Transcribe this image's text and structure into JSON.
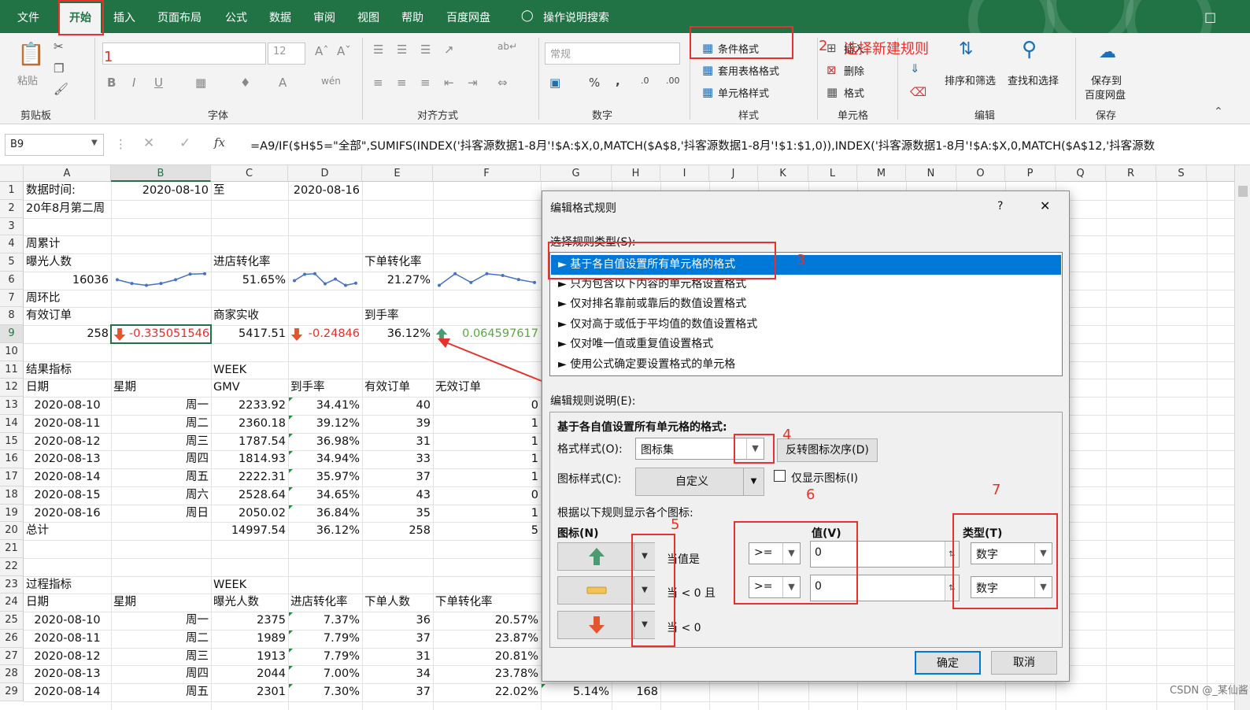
{
  "menu": {
    "items": [
      "文件",
      "开始",
      "插入",
      "页面布局",
      "公式",
      "数据",
      "审阅",
      "视图",
      "帮助",
      "百度网盘",
      "操作说明搜索"
    ],
    "active_index": 1
  },
  "ribbon": {
    "paste": "粘贴",
    "font_size": "12",
    "number_format": "常规",
    "conditional_format": "条件格式",
    "table_format": "套用表格格式",
    "cell_style": "单元格样式",
    "insert": "插入",
    "delete": "删除",
    "format": "格式",
    "sort_filter": "排序和筛选",
    "find_select": "查找和选择",
    "save_to": "保存到",
    "baidu_netdisk": "百度网盘",
    "groups": {
      "clipboard": "剪贴板",
      "font": "字体",
      "align": "对齐方式",
      "number": "数字",
      "style": "样式",
      "cells": "单元格",
      "edit": "编辑",
      "save": "保存"
    }
  },
  "formula_bar": {
    "name_box": "B9",
    "fx": "fx",
    "formula": "=A9/IF($H$5=\"全部\",SUMIFS(INDEX('抖客源数据1-8月'!$A:$X,0,MATCH($A$8,'抖客源数据1-8月'!$1:$1,0)),INDEX('抖客源数据1-8月'!$A:$X,0,MATCH($A$12,'抖客源数"
  },
  "columns": [
    "A",
    "B",
    "C",
    "D",
    "E",
    "F",
    "G",
    "H",
    "I",
    "J",
    "K",
    "L",
    "M",
    "N",
    "O",
    "P",
    "Q",
    "R",
    "S"
  ],
  "rows": [
    "1",
    "2",
    "3",
    "4",
    "5",
    "6",
    "7",
    "8",
    "9",
    "10",
    "11",
    "12",
    "13",
    "14",
    "15",
    "16",
    "17",
    "18",
    "19",
    "20",
    "21",
    "22",
    "23",
    "24",
    "25",
    "26",
    "27",
    "28",
    "29"
  ],
  "cells": [
    [
      "1",
      "A",
      "数据时间:"
    ],
    [
      "1",
      "B",
      "2020-08-10"
    ],
    [
      "1",
      "C",
      "至"
    ],
    [
      "1",
      "D",
      "2020-08-16"
    ],
    [
      "2",
      "A",
      "20年8月第二周"
    ],
    [
      "4",
      "A",
      "周累计"
    ],
    [
      "5",
      "A",
      "曝光人数"
    ],
    [
      "5",
      "C",
      "进店转化率"
    ],
    [
      "5",
      "E",
      "下单转化率"
    ],
    [
      "6",
      "A",
      "16036"
    ],
    [
      "6",
      "C",
      "51.65%"
    ],
    [
      "6",
      "E",
      "21.27%"
    ],
    [
      "7",
      "A",
      "周环比"
    ],
    [
      "8",
      "A",
      "有效订单"
    ],
    [
      "8",
      "C",
      "商家实收"
    ],
    [
      "8",
      "E",
      "到手率"
    ],
    [
      "9",
      "A",
      "258"
    ],
    [
      "9",
      "B",
      "-0.335051546"
    ],
    [
      "9",
      "C",
      "5417.51"
    ],
    [
      "9",
      "D",
      "-0.24846"
    ],
    [
      "9",
      "E",
      "36.12%"
    ],
    [
      "9",
      "F",
      "0.064597617"
    ],
    [
      "11",
      "A",
      "结果指标"
    ],
    [
      "11",
      "C",
      "WEEK"
    ],
    [
      "12",
      "A",
      "日期"
    ],
    [
      "12",
      "B",
      "星期"
    ],
    [
      "12",
      "C",
      "GMV"
    ],
    [
      "12",
      "D",
      "到手率"
    ],
    [
      "12",
      "E",
      "有效订单"
    ],
    [
      "12",
      "F",
      "无效订单"
    ],
    [
      "13",
      "A",
      "2020-08-10"
    ],
    [
      "13",
      "B",
      "周一"
    ],
    [
      "13",
      "C",
      "2233.92"
    ],
    [
      "13",
      "D",
      "34.41%"
    ],
    [
      "13",
      "E",
      "40"
    ],
    [
      "13",
      "F",
      "0"
    ],
    [
      "14",
      "A",
      "2020-08-11"
    ],
    [
      "14",
      "B",
      "周二"
    ],
    [
      "14",
      "C",
      "2360.18"
    ],
    [
      "14",
      "D",
      "39.12%"
    ],
    [
      "14",
      "E",
      "39"
    ],
    [
      "14",
      "F",
      "1"
    ],
    [
      "15",
      "A",
      "2020-08-12"
    ],
    [
      "15",
      "B",
      "周三"
    ],
    [
      "15",
      "C",
      "1787.54"
    ],
    [
      "15",
      "D",
      "36.98%"
    ],
    [
      "15",
      "E",
      "31"
    ],
    [
      "15",
      "F",
      "1"
    ],
    [
      "16",
      "A",
      "2020-08-13"
    ],
    [
      "16",
      "B",
      "周四"
    ],
    [
      "16",
      "C",
      "1814.93"
    ],
    [
      "16",
      "D",
      "34.94%"
    ],
    [
      "16",
      "E",
      "33"
    ],
    [
      "16",
      "F",
      "1"
    ],
    [
      "17",
      "A",
      "2020-08-14"
    ],
    [
      "17",
      "B",
      "周五"
    ],
    [
      "17",
      "C",
      "2222.31"
    ],
    [
      "17",
      "D",
      "35.97%"
    ],
    [
      "17",
      "E",
      "37"
    ],
    [
      "17",
      "F",
      "1"
    ],
    [
      "18",
      "A",
      "2020-08-15"
    ],
    [
      "18",
      "B",
      "周六"
    ],
    [
      "18",
      "C",
      "2528.64"
    ],
    [
      "18",
      "D",
      "34.65%"
    ],
    [
      "18",
      "E",
      "43"
    ],
    [
      "18",
      "F",
      "0"
    ],
    [
      "19",
      "A",
      "2020-08-16"
    ],
    [
      "19",
      "B",
      "周日"
    ],
    [
      "19",
      "C",
      "2050.02"
    ],
    [
      "19",
      "D",
      "36.84%"
    ],
    [
      "19",
      "E",
      "35"
    ],
    [
      "19",
      "F",
      "1"
    ],
    [
      "20",
      "A",
      "总计"
    ],
    [
      "20",
      "C",
      "14997.54"
    ],
    [
      "20",
      "D",
      "36.12%"
    ],
    [
      "20",
      "E",
      "258"
    ],
    [
      "20",
      "F",
      "5"
    ],
    [
      "23",
      "A",
      "过程指标"
    ],
    [
      "23",
      "C",
      "WEEK"
    ],
    [
      "24",
      "A",
      "日期"
    ],
    [
      "24",
      "B",
      "星期"
    ],
    [
      "24",
      "C",
      "曝光人数"
    ],
    [
      "24",
      "D",
      "进店转化率"
    ],
    [
      "24",
      "E",
      "下单人数"
    ],
    [
      "24",
      "F",
      "下单转化率"
    ],
    [
      "25",
      "A",
      "2020-08-10"
    ],
    [
      "25",
      "B",
      "周一"
    ],
    [
      "25",
      "C",
      "2375"
    ],
    [
      "25",
      "D",
      "7.37%"
    ],
    [
      "25",
      "E",
      "36"
    ],
    [
      "25",
      "F",
      "20.57%"
    ],
    [
      "26",
      "A",
      "2020-08-11"
    ],
    [
      "26",
      "B",
      "周二"
    ],
    [
      "26",
      "C",
      "1989"
    ],
    [
      "26",
      "D",
      "7.79%"
    ],
    [
      "26",
      "E",
      "37"
    ],
    [
      "26",
      "F",
      "23.87%"
    ],
    [
      "27",
      "A",
      "2020-08-12"
    ],
    [
      "27",
      "B",
      "周三"
    ],
    [
      "27",
      "C",
      "1913"
    ],
    [
      "27",
      "D",
      "7.79%"
    ],
    [
      "27",
      "E",
      "31"
    ],
    [
      "27",
      "F",
      "20.81%"
    ],
    [
      "28",
      "A",
      "2020-08-13"
    ],
    [
      "28",
      "B",
      "周四"
    ],
    [
      "28",
      "C",
      "2044"
    ],
    [
      "28",
      "D",
      "7.00%"
    ],
    [
      "28",
      "E",
      "34"
    ],
    [
      "28",
      "F",
      "23.78%"
    ],
    [
      "29",
      "A",
      "2020-08-14"
    ],
    [
      "29",
      "B",
      "周五"
    ],
    [
      "29",
      "C",
      "2301"
    ],
    [
      "29",
      "D",
      "7.30%"
    ],
    [
      "29",
      "E",
      "37"
    ],
    [
      "29",
      "F",
      "22.02%"
    ],
    [
      "29",
      "G",
      "5.14%"
    ],
    [
      "29",
      "H",
      "168"
    ]
  ],
  "sparklines": {
    "b6": [
      4,
      3,
      2.5,
      3,
      4,
      5.5,
      5.6
    ],
    "d6": [
      3,
      5,
      5.2,
      2,
      3.5,
      1.5,
      2.2
    ],
    "f6": [
      2.5,
      4.5,
      3,
      4.5,
      4.2,
      3.5,
      3
    ]
  },
  "dialog": {
    "title": "编辑格式规则",
    "help": "?",
    "close": "✕",
    "select_type_label": "选择规则类型(S):",
    "rule_types": [
      "► 基于各自值设置所有单元格的格式",
      "► 只为包含以下内容的单元格设置格式",
      "► 仅对排名靠前或靠后的数值设置格式",
      "► 仅对高于或低于平均值的数值设置格式",
      "► 仅对唯一值或重复值设置格式",
      "► 使用公式确定要设置格式的单元格"
    ],
    "selected_rule": 0,
    "desc_label": "编辑规则说明(E):",
    "desc_heading": "基于各自值设置所有单元格的格式:",
    "format_style_label": "格式样式(O):",
    "format_style_value": "图标集",
    "reverse_btn": "反转图标次序(D)",
    "icon_style_label": "图标样式(C):",
    "icon_style_value": "自定义",
    "show_icon_only": "仅显示图标(I)",
    "rules_heading": "根据以下规则显示各个图标:",
    "icon_col": "图标(N)",
    "value_col": "值(V)",
    "type_col": "类型(T)",
    "icon_rows": [
      {
        "icon": "up-arrow-green",
        "cond": "当值是",
        "op": ">=",
        "value": "0",
        "type": "数字"
      },
      {
        "icon": "dash-yellow",
        "cond": "当 < 0 且",
        "op": ">=",
        "value": "0",
        "type": "数字"
      },
      {
        "icon": "down-arrow-red",
        "cond": "当 < 0",
        "op": "",
        "value": "",
        "type": ""
      }
    ],
    "ok": "确定",
    "cancel": "取消"
  },
  "annotations": {
    "n1": "1",
    "n2": "2",
    "n2_text": "选择新建规则",
    "n3": "3",
    "n4": "4",
    "n5": "5",
    "n6": "6",
    "n7": "7",
    "color": "#e8312a"
  },
  "watermark": "CSDN @_某仙酱",
  "colors": {
    "excel_green": "#217346",
    "selection_blue": "#0078d7",
    "negative": "#e0312a",
    "positive": "#5aa845"
  }
}
